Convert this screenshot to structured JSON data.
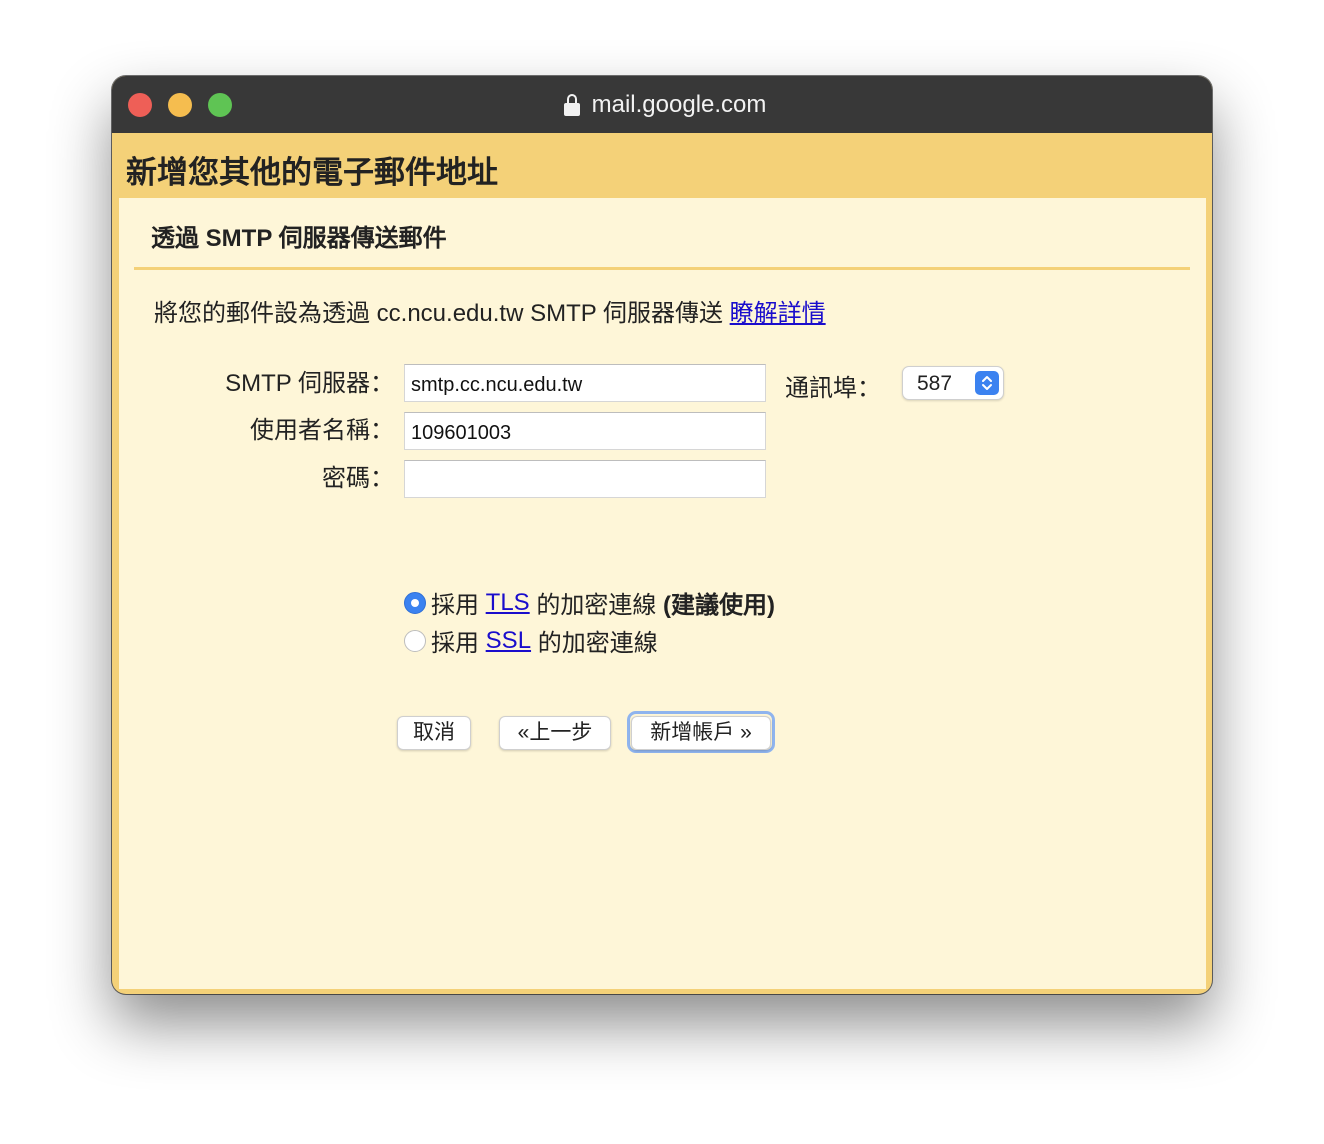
{
  "browser": {
    "url": "mail.google.com",
    "lock_icon": "lock-icon"
  },
  "dialog": {
    "title": "新增您其他的電子郵件地址",
    "section_title": "透過 SMTP 伺服器傳送郵件",
    "intro_text": "將您的郵件設為透過 cc.ncu.edu.tw SMTP 伺服器傳送",
    "learn_more_link": "瞭解詳情"
  },
  "form": {
    "smtp_server_label": "SMTP 伺服器：",
    "smtp_server_value": "smtp.cc.ncu.edu.tw",
    "port_label": "通訊埠：",
    "port_value": "587",
    "username_label": "使用者名稱：",
    "username_value": "109601003",
    "password_label": "密碼：",
    "password_value": "",
    "tls_option": {
      "prefix": "採用",
      "link": "TLS",
      "suffix": "的加密連線",
      "recommended": "(建議使用)",
      "selected": true
    },
    "ssl_option": {
      "prefix": "採用",
      "link": "SSL",
      "suffix": "的加密連線",
      "selected": false
    }
  },
  "buttons": {
    "cancel": "取消",
    "back": "«上一步",
    "add_account": "新增帳戶 »"
  },
  "colors": {
    "header_bg": "#f4d178",
    "panel_bg": "#fef6d8",
    "titlebar_bg": "#383838",
    "link": "#1a0dcc",
    "accent_blue": "#3b82f0"
  }
}
